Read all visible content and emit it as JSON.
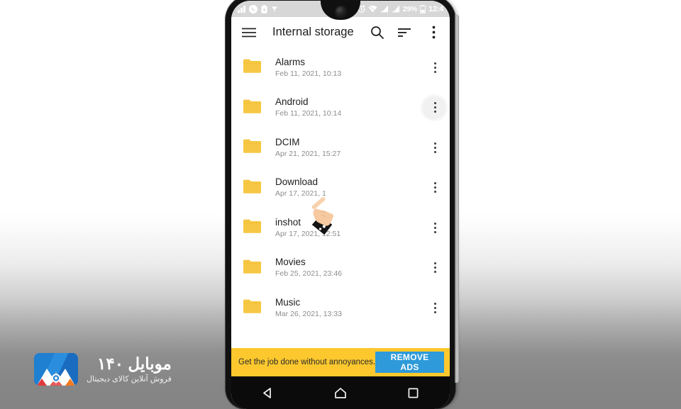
{
  "brand": {
    "title": "موبایل ۱۴۰",
    "subtitle": "فروش آنلاین کالای دیجیتال",
    "logo_icon": "mountain-logo-icon",
    "colors": {
      "blue": "#1f7fd0",
      "red": "#e03a3a",
      "orange": "#f07b22"
    }
  },
  "phone": {
    "notch_icon": "front-camera-icon",
    "statusbar": {
      "left_icons": [
        "signal-chart-icon",
        "phone-call-icon",
        "battery-saver-icon",
        "vpn-icon"
      ],
      "right_icons": [
        "alarm-icon",
        "wifi-icon",
        "sim1-signal-icon",
        "sim2-signal-icon"
      ],
      "battery_percent": "29%",
      "battery_icon": "battery-icon",
      "clock": "12:4"
    },
    "navbar": {
      "back_label": "Back",
      "home_label": "Home",
      "recents_label": "Recent apps",
      "back_icon": "back-triangle-icon",
      "home_icon": "home-pentagon-icon",
      "recents_icon": "recents-square-icon"
    }
  },
  "appbar": {
    "menu_icon": "hamburger-menu-icon",
    "title": "Internal storage",
    "search_icon": "search-icon",
    "sort_icon": "sort-icon",
    "overflow_icon": "more-vertical-icon"
  },
  "files": [
    {
      "name": "Alarms",
      "date": "Feb 11, 2021, 10:13",
      "icon": "folder-icon"
    },
    {
      "name": "Android",
      "date": "Feb 11, 2021, 10:14",
      "icon": "folder-icon"
    },
    {
      "name": "DCIM",
      "date": "Apr 21, 2021, 15:27",
      "icon": "folder-icon"
    },
    {
      "name": "Download",
      "date": "Apr 17, 2021, 1",
      "icon": "folder-icon"
    },
    {
      "name": "inshot",
      "date": "Apr 17, 2021, 12:51",
      "icon": "folder-icon"
    },
    {
      "name": "Movies",
      "date": "Feb 25, 2021, 23:46",
      "icon": "folder-icon"
    },
    {
      "name": "Music",
      "date": "Mar 26, 2021, 13:33",
      "icon": "folder-icon"
    }
  ],
  "ad": {
    "text": "Get the job done without annoyances.",
    "button_label": "REMOVE ADS",
    "banner_color": "#fdc82e",
    "button_color": "#2e9ad9"
  },
  "cursor": {
    "icon": "pointing-hand-cursor-icon"
  }
}
